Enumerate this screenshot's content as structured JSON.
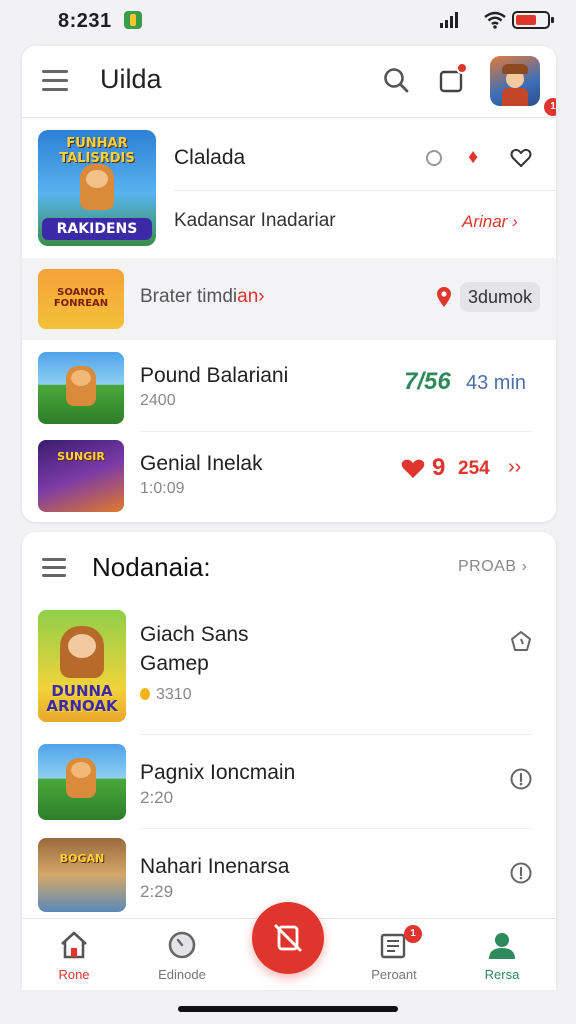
{
  "status_bar": {
    "time": "8:231"
  },
  "app_bar": {
    "title": "Uilda",
    "avatar_badge": "1"
  },
  "featured": {
    "thumb_top": "FUNHAR TALISRDIS",
    "thumb_bottom": "RAKIDENS",
    "name": "Clalada",
    "subtitle": "Kadansar Inadariar",
    "link": "Arinar ›",
    "fire_glyph": "♦"
  },
  "highlight": {
    "thumb_text": "SOANOR FONREAN",
    "text_plain": "Brater timdi",
    "text_accent": "an›",
    "pill": "3dumok"
  },
  "rows": [
    {
      "name": "Pound Balariani",
      "meta": "2400",
      "stat_main": "7/56",
      "stat_sub": "43 min"
    },
    {
      "name": "Genial Inelak",
      "meta": "1:0:09",
      "thumb_text": "SUNGIR",
      "stat_main": "9",
      "stat_sub": "254",
      "chevron": "››"
    }
  ],
  "section": {
    "title": "Nodanaia:",
    "link": "PROAB ›"
  },
  "games": [
    {
      "name_line1": "Giach Sans",
      "name_line2": "Gamep",
      "meta": "3310",
      "thumb_text": "DUNNA ARNOAK"
    },
    {
      "name_line1": "Pagnix Ioncmain",
      "meta": "2:20"
    },
    {
      "name_line1": "Nahari Inenarsa",
      "meta": "2:29",
      "thumb_text": "BOGAN"
    }
  ],
  "bottom_nav": {
    "items": [
      {
        "label": "Rone",
        "icon": "home-icon"
      },
      {
        "label": "Edinode",
        "icon": "clock-icon"
      },
      {
        "label": "Peroant",
        "icon": "library-icon",
        "badge": "1"
      },
      {
        "label": "Rersa",
        "icon": "profile-icon"
      }
    ],
    "fab_icon": "no-phone-icon"
  },
  "colors": {
    "accent_red": "#e0352c",
    "accent_green": "#2e8a5a",
    "accent_blue": "#4c6fa8"
  }
}
